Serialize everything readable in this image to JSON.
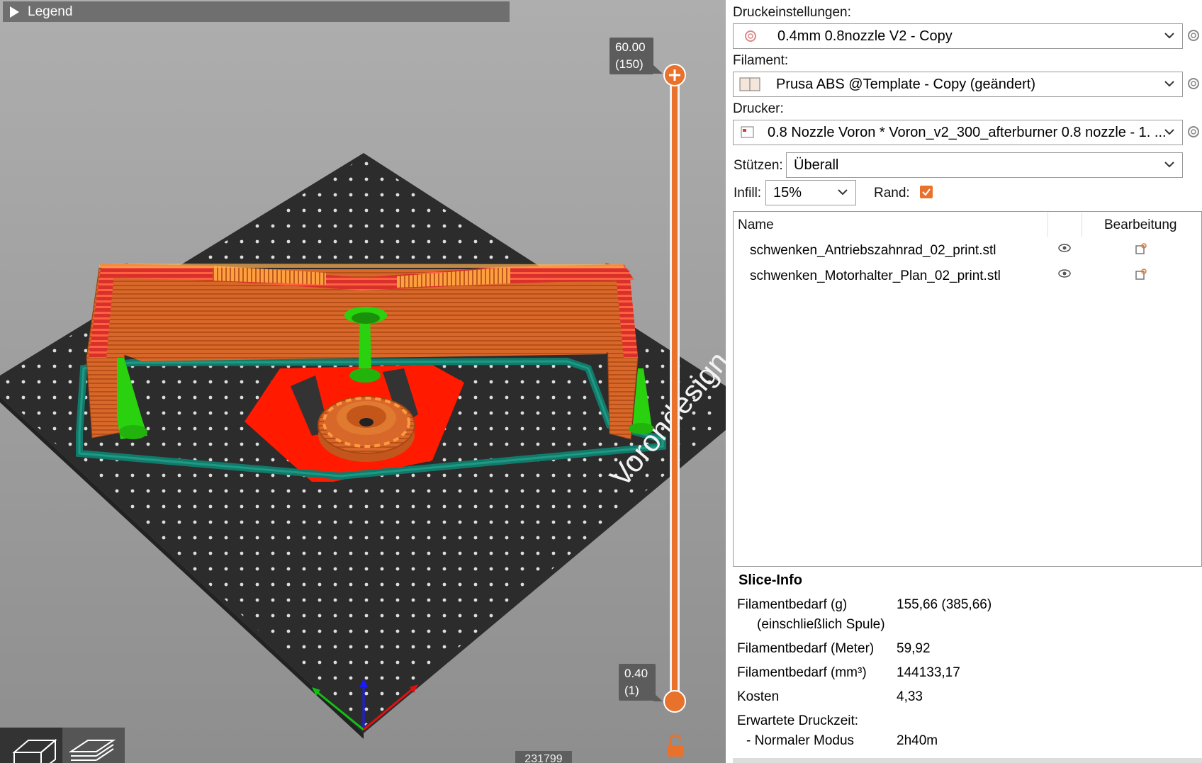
{
  "viewport": {
    "legend_label": "Legend",
    "top_slider_value": "60.00",
    "top_slider_layer": "(150)",
    "bottom_slider_value": "0.40",
    "bottom_slider_layer": "(1)",
    "bed_logo_text": "Vorondesign",
    "partial_count": "231799"
  },
  "settings": {
    "print_label": "Druckeinstellungen:",
    "print_value": "0.4mm 0.8nozzle V2 - Copy",
    "filament_label": "Filament:",
    "filament_value": "Prusa ABS @Template - Copy (geändert)",
    "printer_label": "Drucker:",
    "printer_value": "0.8 Nozzle Voron  * Voron_v2_300_afterburner 0.8 nozzle - 1. ...",
    "supports_label": "Stützen:",
    "supports_value": "Überall",
    "infill_label": "Infill:",
    "infill_value": "15%",
    "brim_label": "Rand:",
    "brim_checked": true
  },
  "object_list": {
    "col_name": "Name",
    "col_edit": "Bearbeitung",
    "rows": [
      {
        "name": "schwenken_Antriebszahnrad_02_print.stl"
      },
      {
        "name": "schwenken_Motorhalter_Plan_02_print.stl"
      }
    ]
  },
  "slice_info": {
    "title": "Slice-Info",
    "rows": [
      {
        "key": "Filamentbedarf (g)",
        "value": "155,66 (385,66)"
      },
      {
        "key": "(einschließlich Spule)",
        "value": ""
      },
      {
        "key": "Filamentbedarf (Meter)",
        "value": "59,92"
      },
      {
        "key": "Filamentbedarf (mm³)",
        "value": "144133,17"
      },
      {
        "key": "Kosten",
        "value": "4,33"
      },
      {
        "key": "Erwartete Druckzeit:",
        "value": ""
      },
      {
        "key": "- Normaler Modus",
        "value": "2h40m"
      }
    ]
  },
  "colors": {
    "accent": "#e8722c",
    "model_orange": "#d9692a",
    "support_green": "#29d10e",
    "brim_teal": "#127a6a",
    "first_layer_red": "#ff1a00",
    "bed": "#2b2b2b"
  },
  "icons": [
    "play-icon",
    "gear-icon",
    "filament-icon",
    "printer-icon",
    "chevron-down-icon",
    "eye-icon",
    "edit-icon",
    "lock-icon",
    "cube-view-icon",
    "layers-view-icon"
  ]
}
